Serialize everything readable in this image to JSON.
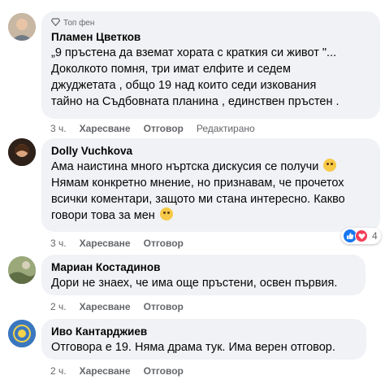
{
  "comments": [
    {
      "badge": "Топ фен",
      "name": "Пламен Цветков",
      "lines": [
        "„9 пръстена да вземат хората с краткия си живот \"...",
        "Доколкото помня, три имат елфите и седем",
        "джуджетата , общо 19 над които седи изкования",
        "тайно на Съдбовната планина , единствен пръстен ."
      ],
      "time": "3 ч.",
      "like": "Харесване",
      "reply": "Отговор",
      "edited": "Редактирано"
    },
    {
      "name": "Dolly Vuchkova",
      "lines": [
        "Ама наистина много нъртска дискусия се получи",
        "Нямам конкретно мнение, но признавам, че прочетох",
        "всички коментари, защото ми стана интересно. Какво",
        "говори това за мен"
      ],
      "time": "3 ч.",
      "like": "Харесване",
      "reply": "Отговор",
      "reactions_count": "4"
    },
    {
      "name": "Мариан Костадинов",
      "lines": [
        "Дори не знаех, че има още пръстени, освен първия."
      ],
      "time": "2 ч.",
      "like": "Харесване",
      "reply": "Отговор"
    },
    {
      "name": "Иво Кантарджиев",
      "lines": [
        "Отговора е 19. Няма драма тук. Има верен отговор."
      ],
      "time": "2 ч.",
      "like": "Харесване",
      "reply": "Отговор"
    }
  ]
}
